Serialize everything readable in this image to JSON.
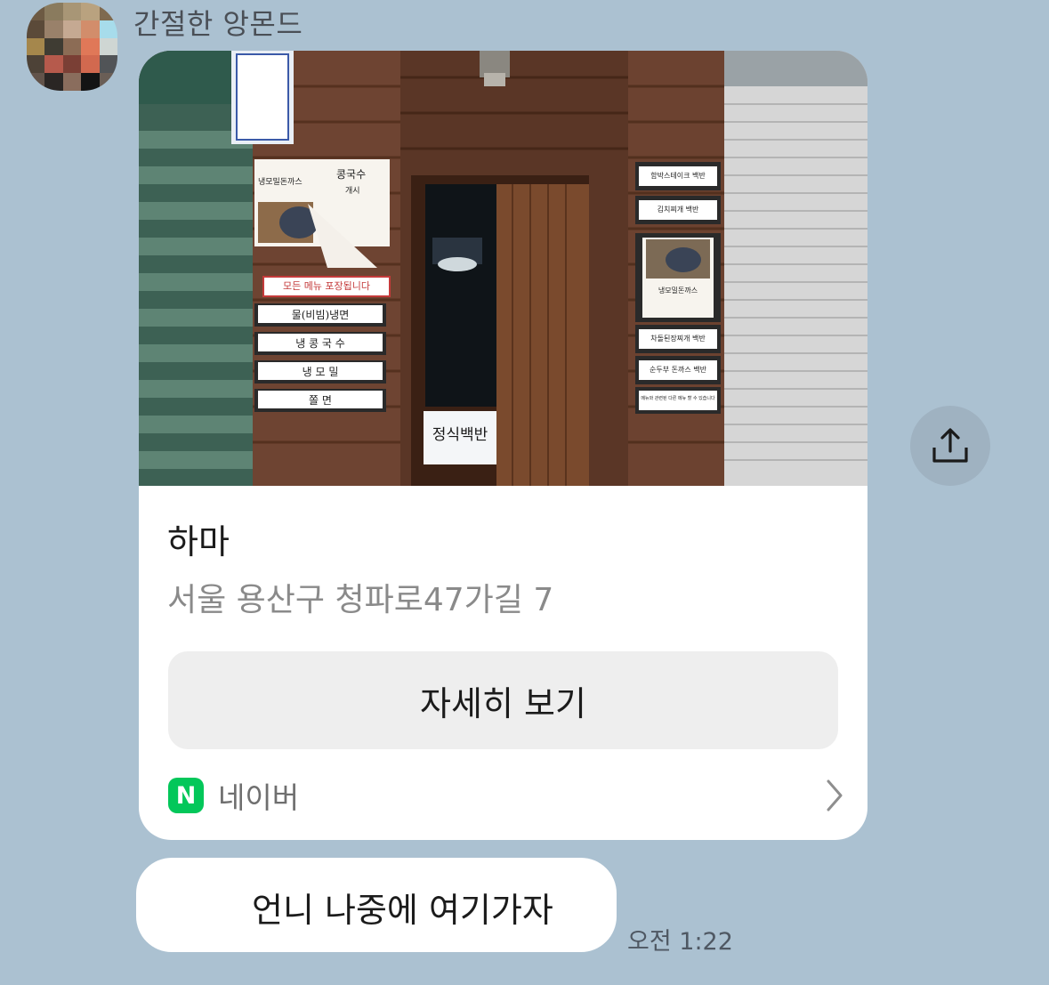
{
  "sender": {
    "name": "간절한 앙몬드"
  },
  "card": {
    "place_name": "하마",
    "address": "서울 용산구 청파로47가길 7",
    "detail_button_label": "자세히 보기",
    "source": {
      "icon_letter": "N",
      "label": "네이버"
    },
    "photo": {
      "signs_left": [
        "모든 메뉴 포장됩니다",
        "물(비빔)냉면",
        "냉 콩 국 수",
        "냉 모 밀",
        "쫄 면"
      ],
      "poster_left": [
        "냉모밀돈까스",
        "콩국수",
        "개시"
      ],
      "signs_right": [
        "함박스테이크 백반",
        "김치찌개 백반",
        "냉모밀돈까스",
        "차돌된장찌개 백반",
        "순두부 돈까스 백반",
        "메뉴와 관련된 다른 메뉴 할 수 있습니다"
      ],
      "door_sign": "정식백반"
    }
  },
  "message": {
    "text": "언니 나중에 여기가자",
    "time": "오전 1:22"
  },
  "colors": {
    "background": "#abc1d1",
    "naver_green": "#03c75a",
    "bubble": "#ffffff"
  }
}
